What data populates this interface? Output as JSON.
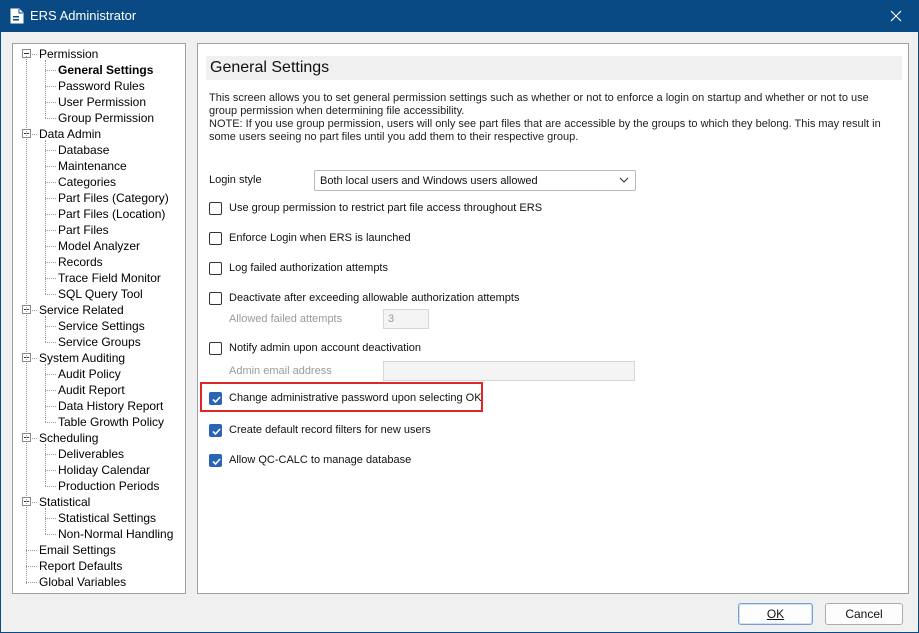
{
  "window": {
    "title": "ERS Administrator"
  },
  "tree": [
    {
      "label": "Permission",
      "level": 0,
      "toggle": true
    },
    {
      "label": "General Settings",
      "level": 1,
      "selected": true
    },
    {
      "label": "Password Rules",
      "level": 1
    },
    {
      "label": "User Permission",
      "level": 1
    },
    {
      "label": "Group Permission",
      "level": 1
    },
    {
      "label": "Data Admin",
      "level": 0,
      "toggle": true
    },
    {
      "label": "Database",
      "level": 1
    },
    {
      "label": "Maintenance",
      "level": 1
    },
    {
      "label": "Categories",
      "level": 1
    },
    {
      "label": "Part Files (Category)",
      "level": 1
    },
    {
      "label": "Part Files (Location)",
      "level": 1
    },
    {
      "label": "Part Files",
      "level": 1
    },
    {
      "label": "Model Analyzer",
      "level": 1
    },
    {
      "label": "Records",
      "level": 1
    },
    {
      "label": "Trace Field Monitor",
      "level": 1
    },
    {
      "label": "SQL Query Tool",
      "level": 1
    },
    {
      "label": "Service Related",
      "level": 0,
      "toggle": true
    },
    {
      "label": "Service Settings",
      "level": 1
    },
    {
      "label": "Service Groups",
      "level": 1
    },
    {
      "label": "System Auditing",
      "level": 0,
      "toggle": true
    },
    {
      "label": "Audit Policy",
      "level": 1
    },
    {
      "label": "Audit Report",
      "level": 1
    },
    {
      "label": "Data History Report",
      "level": 1
    },
    {
      "label": "Table Growth Policy",
      "level": 1
    },
    {
      "label": "Scheduling",
      "level": 0,
      "toggle": true
    },
    {
      "label": "Deliverables",
      "level": 1
    },
    {
      "label": "Holiday Calendar",
      "level": 1
    },
    {
      "label": "Production Periods",
      "level": 1
    },
    {
      "label": "Statistical",
      "level": 0,
      "toggle": true
    },
    {
      "label": "Statistical Settings",
      "level": 1
    },
    {
      "label": "Non-Normal Handling",
      "level": 1
    },
    {
      "label": "Email Settings",
      "level": 0
    },
    {
      "label": "Report Defaults",
      "level": 0
    },
    {
      "label": "Global Variables",
      "level": 0
    }
  ],
  "panel": {
    "heading": "General Settings",
    "description_1": "This screen allows you to set general permission settings such as whether or not to enforce a login on startup and whether or not to use group permission when determining file accessibility.",
    "description_2": "NOTE: If you use group permission, users will only see part files that are accessible by the groups to which they belong. This may result in some users seeing no part files until you add them to their respective group.",
    "login_style_label": "Login style",
    "login_style_value": "Both local users and Windows users allowed",
    "use_group_permission": {
      "label": "Use group permission to restrict part file access throughout ERS",
      "checked": false
    },
    "enforce_login": {
      "label": "Enforce Login when ERS is launched",
      "checked": false
    },
    "log_failed": {
      "label": "Log failed authorization attempts",
      "checked": false
    },
    "deactivate": {
      "label": "Deactivate after exceeding allowable authorization attempts",
      "checked": false
    },
    "allowed_attempts_label": "Allowed failed attempts",
    "allowed_attempts_value": "3",
    "notify_admin": {
      "label": "Notify admin upon account deactivation",
      "checked": false
    },
    "admin_email_label": "Admin email address",
    "admin_email_value": "",
    "change_password": {
      "label": "Change administrative password upon selecting OK",
      "checked": true
    },
    "create_filters": {
      "label": "Create default record filters for new users",
      "checked": true
    },
    "allow_qccalc": {
      "label": "Allow QC-CALC to manage database",
      "checked": true
    }
  },
  "buttons": {
    "ok_label": "OK",
    "cancel_label": "Cancel"
  },
  "colors": {
    "titlebar": "#0a4a84",
    "checkbox_checked": "#2a64b4",
    "highlight_box": "#e0262b"
  }
}
